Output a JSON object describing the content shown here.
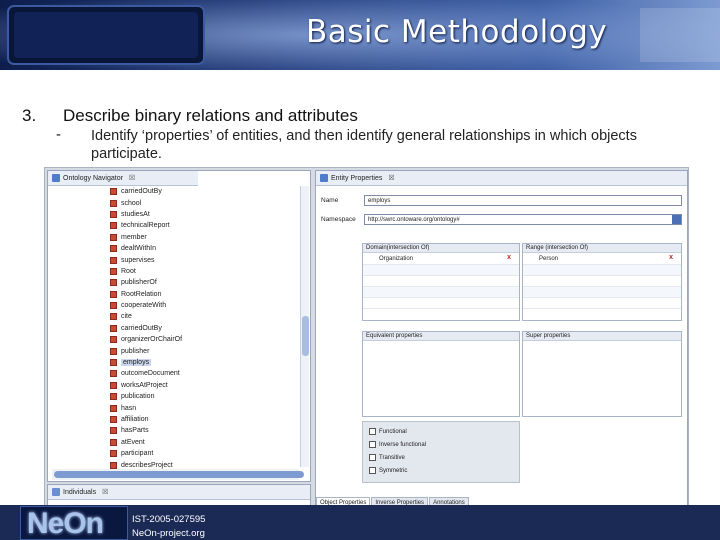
{
  "header": {
    "title": "Basic Methodology"
  },
  "bullet": {
    "number": "3.",
    "heading": "Describe binary relations and attributes",
    "dash": "-",
    "text": "Identify ‘properties’ of entities, and then identify general relationships in which objects participate."
  },
  "navigator": {
    "tab_label": "Ontology Navigator",
    "tab_close": "☒",
    "items": [
      "carriedOutBy",
      "school",
      "studiesAt",
      "technicalReport",
      "member",
      "dealtWithIn",
      "supervises",
      "Root",
      "publisherOf",
      "RootRelation",
      "cooperateWith",
      "cite",
      "carriedOutBy",
      "organizerOrChairOf",
      "publisher",
      "employs",
      "outcomeDocument",
      "worksAtProject",
      "publication",
      "hasn",
      "affiliation",
      "hasParts",
      "atEvent",
      "participant",
      "describesProject"
    ],
    "selected": "employs"
  },
  "individuals": {
    "tab_label": "Individuals",
    "tab_close": "☒"
  },
  "entity_properties": {
    "tab_label": "Entity Properties",
    "tab_close": "☒",
    "name_label": "Name",
    "name_value": "employs",
    "namespace_label": "Namespace",
    "namespace_value": "http://swrc.ontoware.org/ontology#",
    "domain_header": "Domain(intersection Of)",
    "domain_value": "Organization",
    "range_header": "Range (intersection Of)",
    "range_value": "Person",
    "delete_mark": "x",
    "equivalent_header": "Equivalent properties",
    "super_header": "Super properties",
    "checkboxes": [
      "Functional",
      "Inverse functional",
      "Transitive",
      "Symmetric"
    ],
    "bottom_tabs": [
      "Object Properties",
      "Inverse Properties",
      "Annotations"
    ]
  },
  "footer": {
    "logo": "NeOn",
    "line1": "IST-2005-027595",
    "line2": "NeOn-project.org"
  },
  "colors": {
    "header_dark": "#0d1e4d",
    "header_light": "#5a79b8",
    "selection": "#c9d6ee",
    "delete_red": "#c81e1e"
  }
}
